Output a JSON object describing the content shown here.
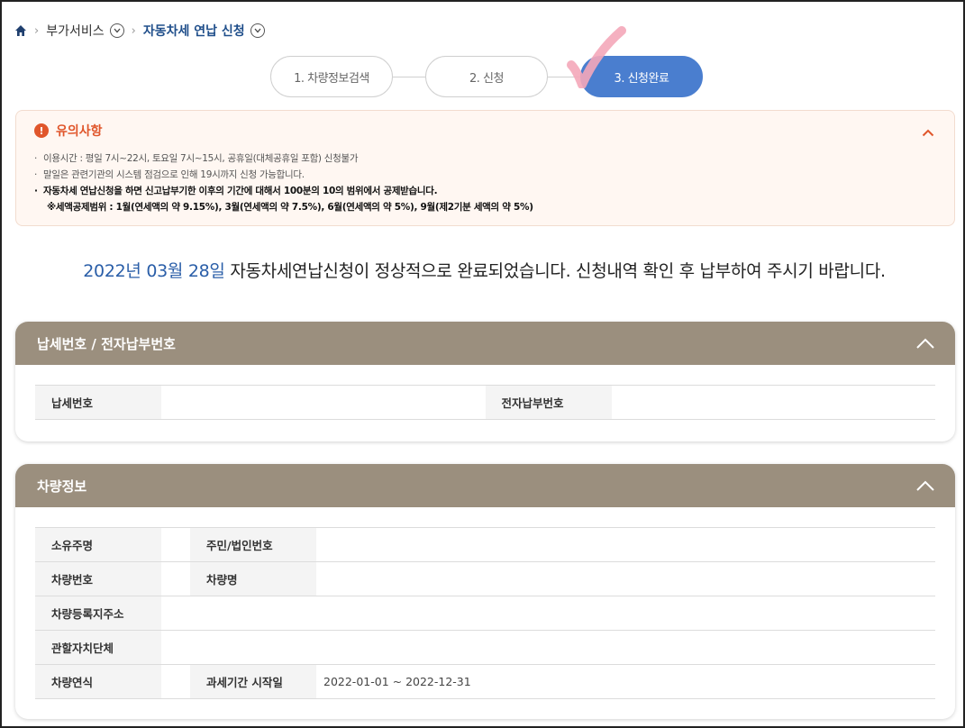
{
  "breadcrumb": {
    "home_icon": "home-icon",
    "items": [
      "부가서비스",
      "자동차세 연납 신청"
    ]
  },
  "steps": [
    {
      "label": "1. 차량정보검색",
      "active": false
    },
    {
      "label": "2. 신청",
      "active": false
    },
    {
      "label": "3. 신청완료",
      "active": true
    }
  ],
  "notice": {
    "title": "유의사항",
    "items": [
      "이용시간 : 평일 7시~22시, 토요일 7시~15시, 공휴일(대체공휴일 포함) 신청불가",
      "말일은 관련기관의 시스템 점검으로 인해 19시까지 신청 가능합니다.",
      "자동차세 연납신청을 하면 신고납부기한 이후의 기간에 대해서 100분의 10의 범위에서 공제받습니다."
    ],
    "deduction_note": "※세액공제범위 : 1월(연세액의 약 9.15%), 3월(연세액의 약 7.5%), 6월(연세액의 약 5%), 9월(제2기분 세액의 약 5%)"
  },
  "completion": {
    "date": "2022년 03월 28일",
    "message": " 자동차세연납신청이 정상적으로 완료되었습니다. 신청내역 확인 후 납부하여 주시기 바랍니다."
  },
  "tax_panel": {
    "title": "납세번호 / 전자납부번호",
    "tax_number_label": "납세번호",
    "tax_number_value": "",
    "epay_number_label": "전자납부번호",
    "epay_number_value": ""
  },
  "vehicle_panel": {
    "title": "차량정보",
    "owner_label": "소유주명",
    "owner_value": "",
    "id_label": "주민/법인번호",
    "id_value": "",
    "plate_label": "차량번호",
    "plate_value": "",
    "model_label": "차량명",
    "model_value": "",
    "address_label": "차량등록지주소",
    "address_value": "",
    "authority_label": "관할자치단체",
    "authority_value": "",
    "year_label": "차량연식",
    "year_value": "",
    "period_label": "과세기간 시작일",
    "period_value": "2022-01-01 ~ 2022-12-31"
  },
  "colors": {
    "accent_blue": "#4a7ecf",
    "panel_header": "#9b8f7e",
    "notice_orange": "#e0562b"
  }
}
